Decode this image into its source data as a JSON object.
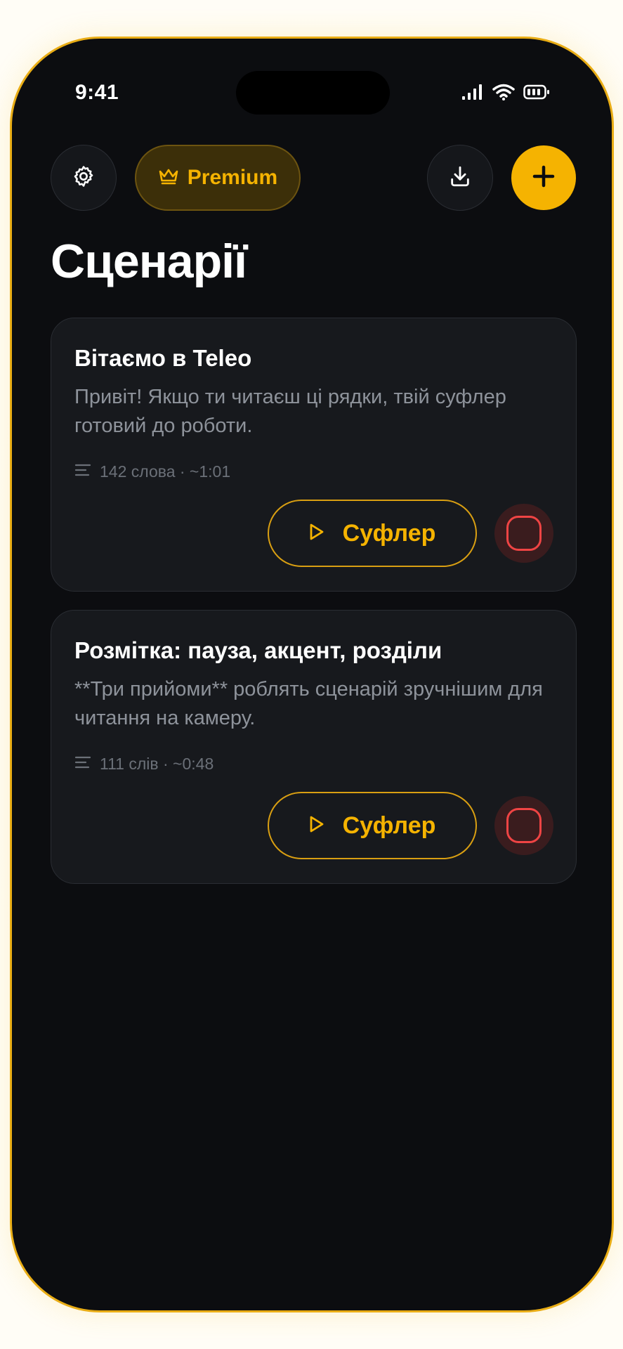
{
  "status_bar": {
    "time": "9:41",
    "icons": [
      "cellular-signal-icon",
      "wifi-icon",
      "battery-icon"
    ]
  },
  "toolbar": {
    "settings_icon": "gear-icon",
    "premium_label": "Premium",
    "premium_icon": "crown-icon",
    "download_icon": "download-icon",
    "add_icon": "plus-icon"
  },
  "page": {
    "title": "Сценарії"
  },
  "scripts": [
    {
      "title": "Вітаємо в Teleo",
      "preview": "Привіт! Якщо ти читаєш ці рядки, твій суфлер готовий до роботи.",
      "meta": "142 слова · ~1:01",
      "prompter_label": "Суфлер"
    },
    {
      "title": "Розмітка: пауза, акцент, розділи",
      "preview": "**Три прийоми** роблять сценарій зручнішим для читання на камеру.",
      "meta": "111 слів · ~0:48",
      "prompter_label": "Суфлер"
    }
  ],
  "colors": {
    "accent": "#f5b301",
    "background": "#0c0d10",
    "card": "#17191d",
    "record": "#ef4444"
  }
}
